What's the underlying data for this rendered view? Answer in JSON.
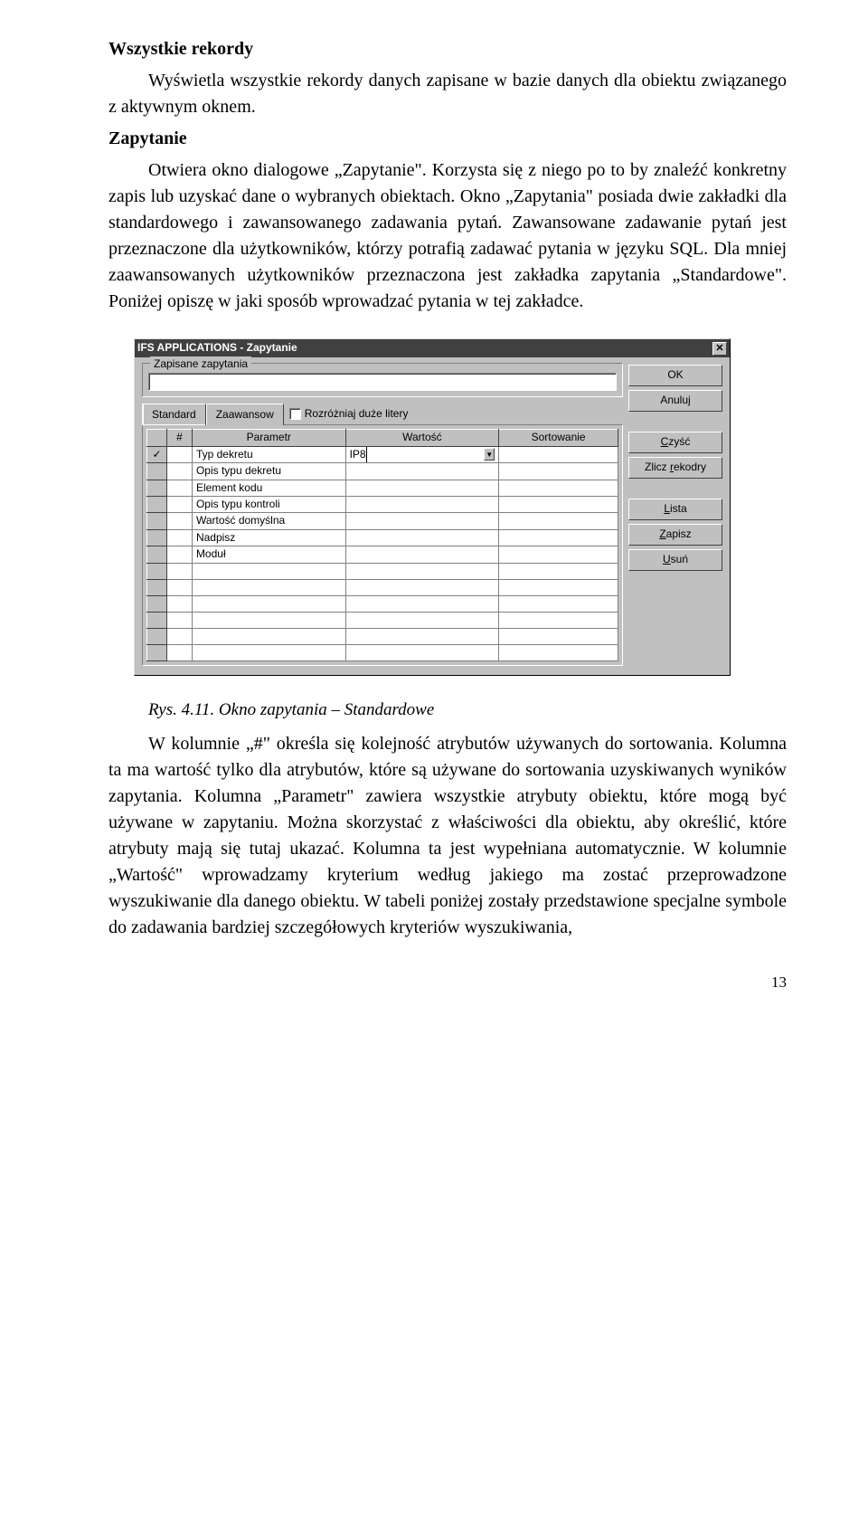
{
  "heading1": "Wszystkie rekordy",
  "para1": "Wyświetla wszystkie rekordy danych zapisane w bazie danych dla obiektu związanego z aktywnym oknem.",
  "heading2": "Zapytanie",
  "para2": "Otwiera okno dialogowe „Zapytanie\". Korzysta się z niego po to by znaleźć konkretny zapis lub uzyskać dane o wybranych obiektach. Okno „Zapytania\" posiada dwie zakładki dla standardowego i zawansowanego zadawania pytań. Zawansowane zadawanie pytań jest przeznaczone dla użytkowników, którzy potrafią zadawać pytania w języku SQL. Dla mniej zaawansowanych użytkowników przeznaczona jest zakładka zapytania „Standardowe\". Poniżej opiszę w jaki sposób wprowadzać pytania w tej zakładce.",
  "dialog": {
    "title": "IFS APPLICATIONS - Zapytanie",
    "saved_queries_legend": "Zapisane zapytania",
    "saved_query_value": "",
    "tabs": {
      "standard": "Standard",
      "advanced": "Zaawansow"
    },
    "case_sensitive_label": "Rozróżniaj duże litery",
    "columns": {
      "hash": "#",
      "param": "Parametr",
      "value": "Wartość",
      "sort": "Sortowanie"
    },
    "rows": [
      {
        "marker": "✓",
        "hash": "",
        "param": "Typ dekretu",
        "value": "IP8",
        "has_dd": true
      },
      {
        "marker": "",
        "hash": "",
        "param": "Opis typu dekretu",
        "value": "",
        "has_dd": false
      },
      {
        "marker": "",
        "hash": "",
        "param": "Element kodu",
        "value": "",
        "has_dd": false
      },
      {
        "marker": "",
        "hash": "",
        "param": "Opis typu kontroli",
        "value": "",
        "has_dd": false
      },
      {
        "marker": "",
        "hash": "",
        "param": "Wartość domyślna",
        "value": "",
        "has_dd": false
      },
      {
        "marker": "",
        "hash": "",
        "param": "Nadpisz",
        "value": "",
        "has_dd": false
      },
      {
        "marker": "",
        "hash": "",
        "param": "Moduł",
        "value": "",
        "has_dd": false
      },
      {
        "marker": "",
        "hash": "",
        "param": "",
        "value": "",
        "has_dd": false
      },
      {
        "marker": "",
        "hash": "",
        "param": "",
        "value": "",
        "has_dd": false
      },
      {
        "marker": "",
        "hash": "",
        "param": "",
        "value": "",
        "has_dd": false
      },
      {
        "marker": "",
        "hash": "",
        "param": "",
        "value": "",
        "has_dd": false
      },
      {
        "marker": "",
        "hash": "",
        "param": "",
        "value": "",
        "has_dd": false
      },
      {
        "marker": "",
        "hash": "",
        "param": "",
        "value": "",
        "has_dd": false
      }
    ],
    "buttons": {
      "ok": "OK",
      "cancel": "Anuluj",
      "clear_pre": "",
      "clear_u": "C",
      "clear_post": "zyść",
      "count_pre": "Zlicz ",
      "count_u": "r",
      "count_post": "ekodry",
      "list_pre": "",
      "list_u": "L",
      "list_post": "ista",
      "save_pre": "",
      "save_u": "Z",
      "save_post": "apisz",
      "delete_pre": "",
      "delete_u": "U",
      "delete_post": "suń"
    }
  },
  "caption": "Rys. 4.11. Okno zapytania – Standardowe",
  "para3": "W kolumnie „#\" określa się kolejność atrybutów używanych do sortowania. Kolumna ta ma wartość tylko dla atrybutów, które są używane do sortowania uzyskiwanych wyników zapytania. Kolumna „Parametr\" zawiera wszystkie atrybuty obiektu, które mogą być używane w zapytaniu. Można skorzystać z właściwości dla obiektu, aby określić, które atrybuty mają się tutaj ukazać. Kolumna ta jest wypełniana automatycznie. W kolumnie „Wartość\" wprowadzamy kryterium według jakiego ma zostać przeprowadzone wyszukiwanie dla danego obiektu. W tabeli poniżej zostały przedstawione specjalne symbole do zadawania bardziej szczegółowych kryteriów wyszukiwania,",
  "page": "13"
}
